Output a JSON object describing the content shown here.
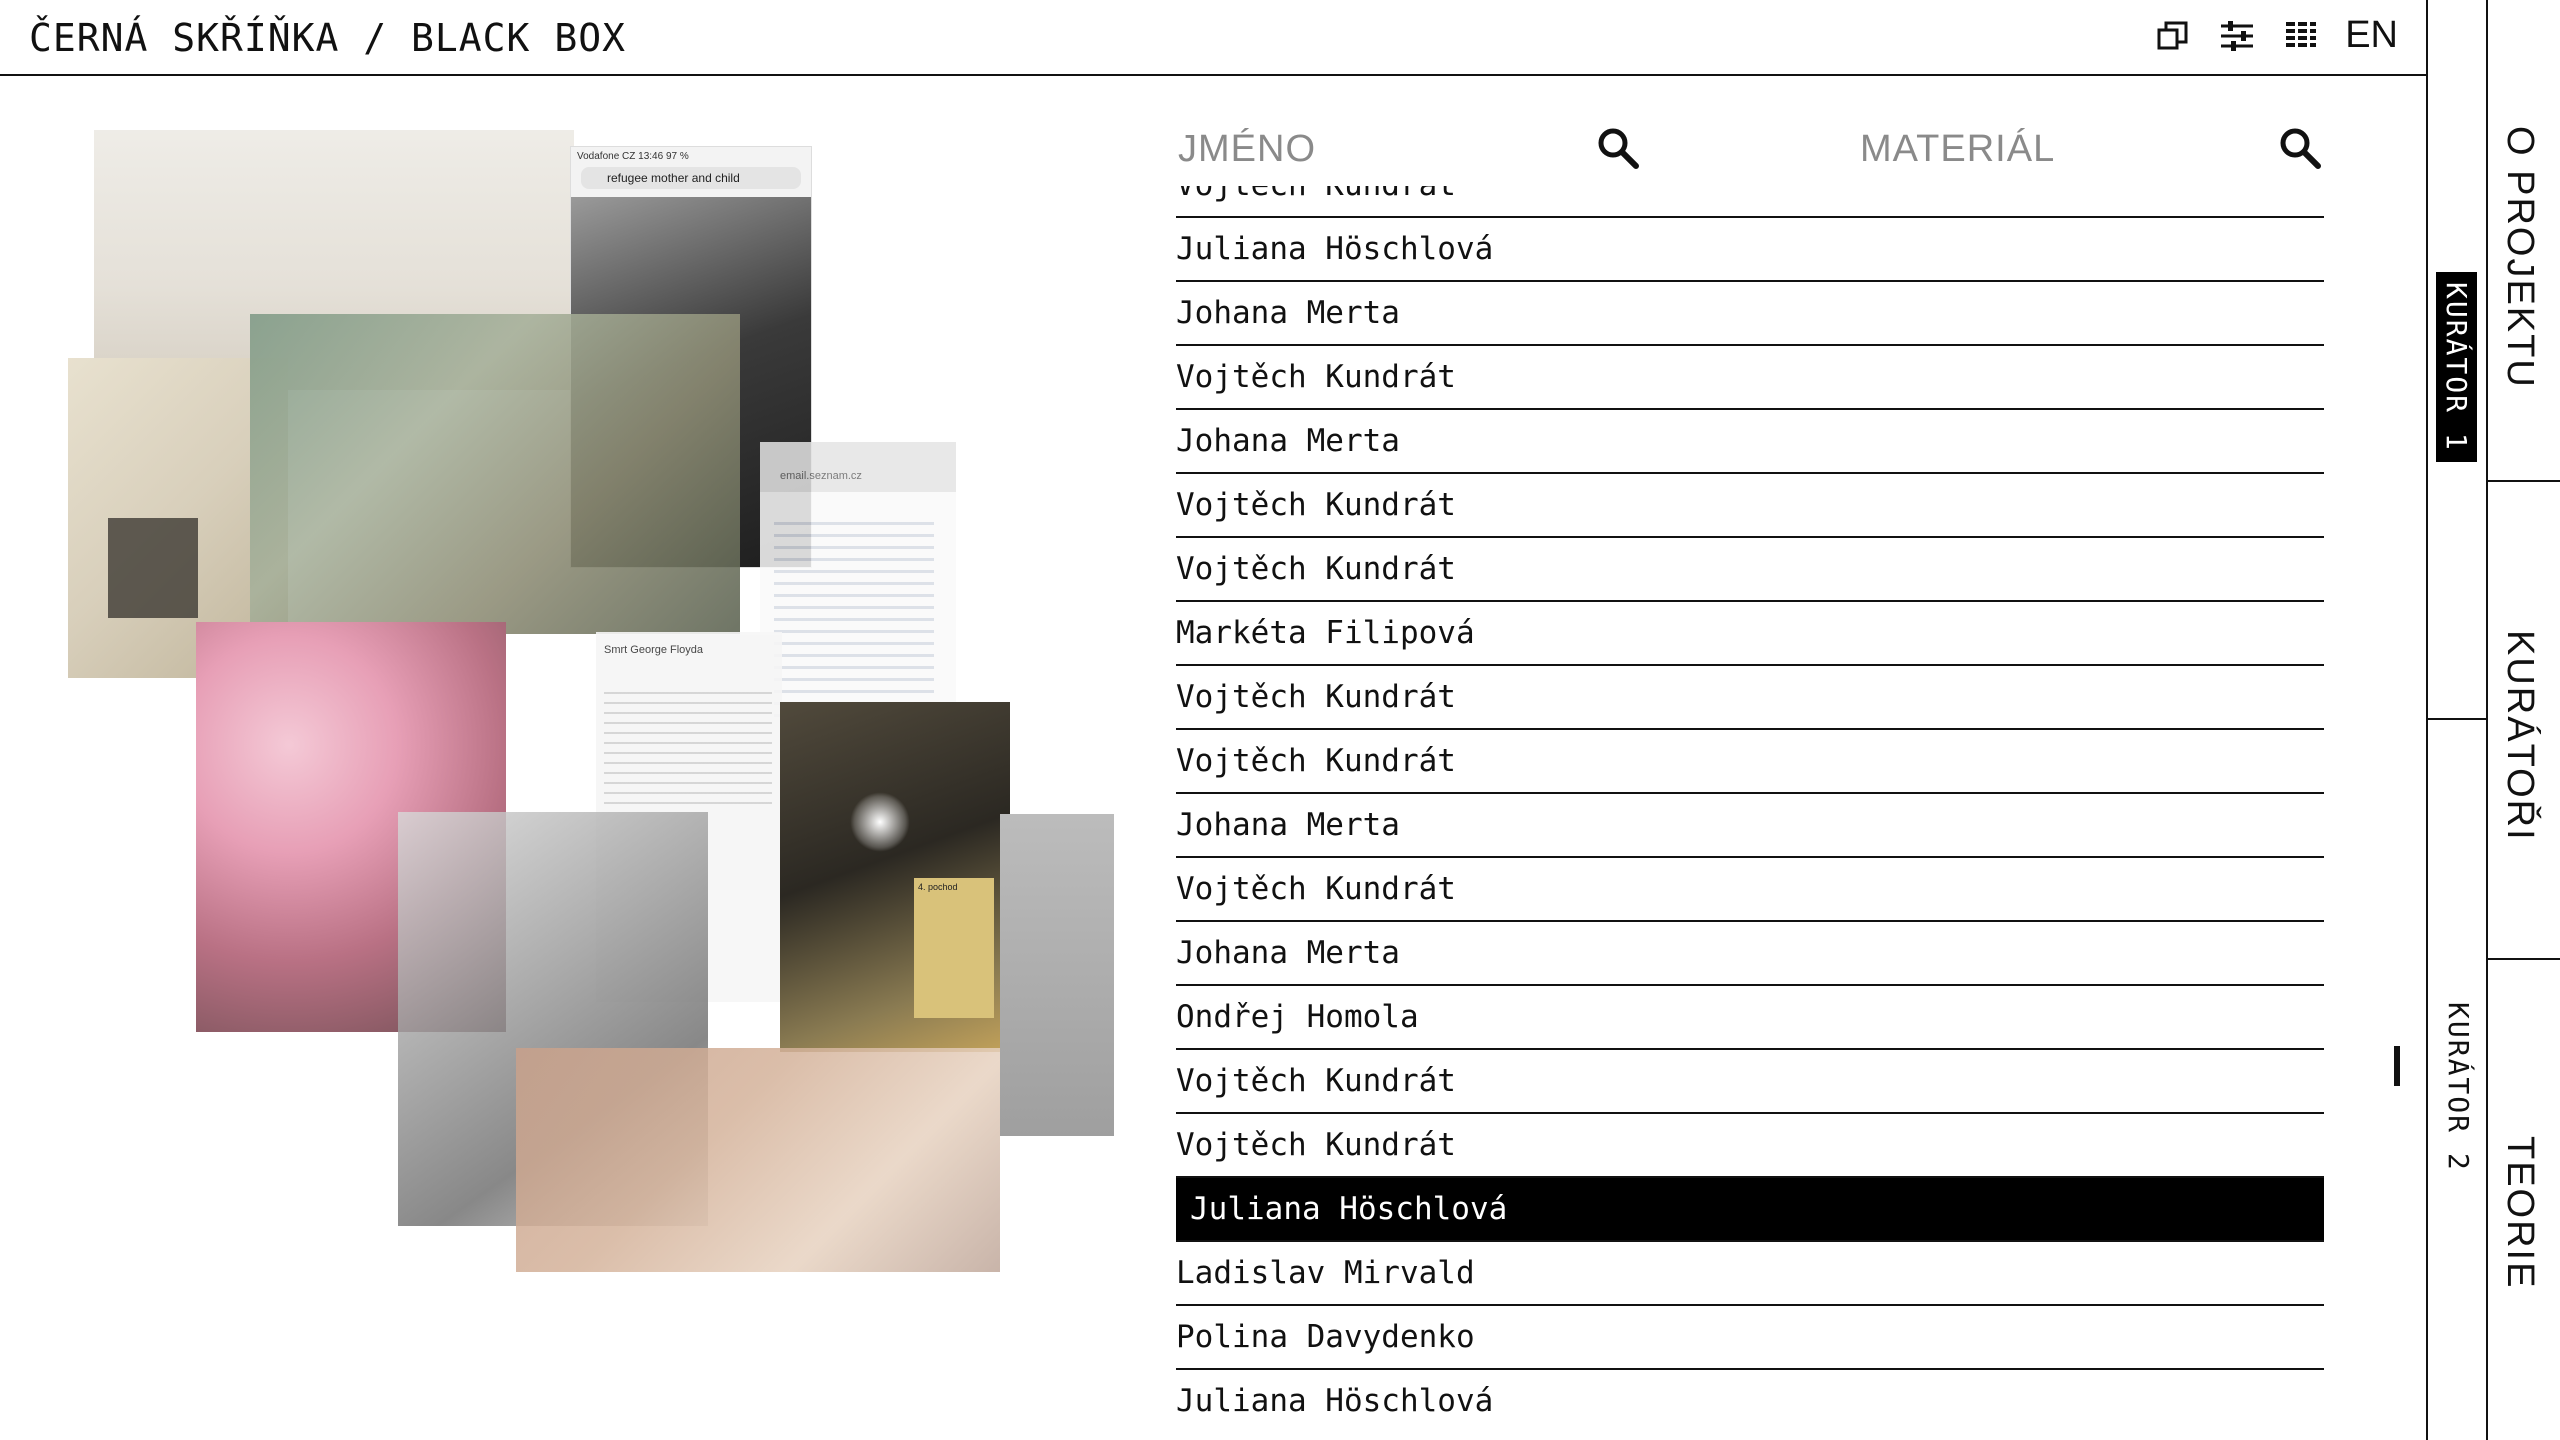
{
  "header": {
    "title": "ČERNÁ SKŘÍŇKA / BLACK BOX",
    "icons": [
      "windows-icon",
      "sliders-icon",
      "grid-columns-icon"
    ],
    "lang": "EN"
  },
  "side_nav": {
    "about": "O PROJEKTU",
    "curator1": "KURÁTOR 1",
    "curators": "KURÁTOŘI",
    "curator2": "KURÁTOR 2",
    "theory": "TEORIE"
  },
  "search": {
    "name_label": "JMÉNO",
    "material_label": "MATERIÁL"
  },
  "collage": {
    "phone_status": "Vodafone CZ  13:46  97 %",
    "phone_query": "refugee mother and child",
    "mail_header": "email.seznam.cz",
    "article_title": "Smrt George Floyda",
    "note_title": "4. pochod"
  },
  "names": [
    "Vojtěch Kundrát",
    "Juliana Höschlová",
    "Johana Merta",
    "Vojtěch Kundrát",
    "Johana Merta",
    "Vojtěch Kundrát",
    "Vojtěch Kundrát",
    "Markéta Filipová",
    "Vojtěch Kundrát",
    "Vojtěch Kundrát",
    "Johana Merta",
    "Vojtěch Kundrát",
    "Johana Merta",
    "Ondřej Homola",
    "Vojtěch Kundrát",
    "Vojtěch Kundrát",
    "Juliana Höschlová",
    "Ladislav Mirvald",
    "Polina Davydenko",
    "Juliana Höschlová"
  ],
  "selected_index": 16
}
